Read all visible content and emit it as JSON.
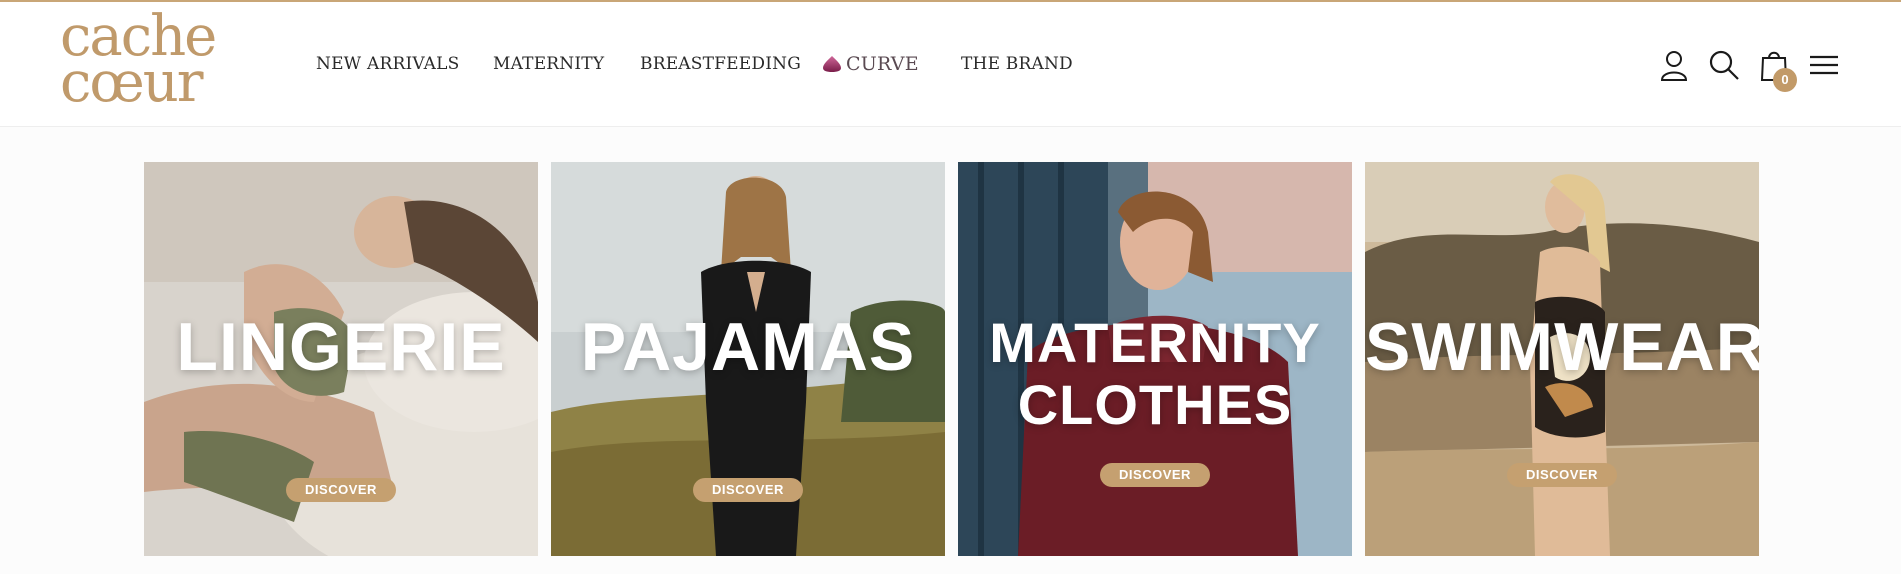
{
  "brand": {
    "logo_line1": "cache",
    "logo_line2": "cœur",
    "accent": "#c29a68"
  },
  "nav": {
    "items": [
      {
        "label": "NEW ARRIVALS"
      },
      {
        "label": "MATERNITY"
      },
      {
        "label": "BREASTFEEDING"
      },
      {
        "label": "CURVE"
      },
      {
        "label": "THE BRAND"
      }
    ]
  },
  "header_icons": {
    "account": "user-icon",
    "search": "search-icon",
    "cart": "shopping-bag-icon",
    "cart_count": "0",
    "menu": "hamburger-menu-icon"
  },
  "categories": [
    {
      "title": "LINGERIE",
      "button": "DISCOVER"
    },
    {
      "title": "PAJAMAS",
      "button": "DISCOVER"
    },
    {
      "title_line1": "MATERNITY",
      "title_line2": "CLOTHES",
      "button": "DISCOVER"
    },
    {
      "title": "SWIMWEAR",
      "button": "DISCOVER"
    }
  ]
}
